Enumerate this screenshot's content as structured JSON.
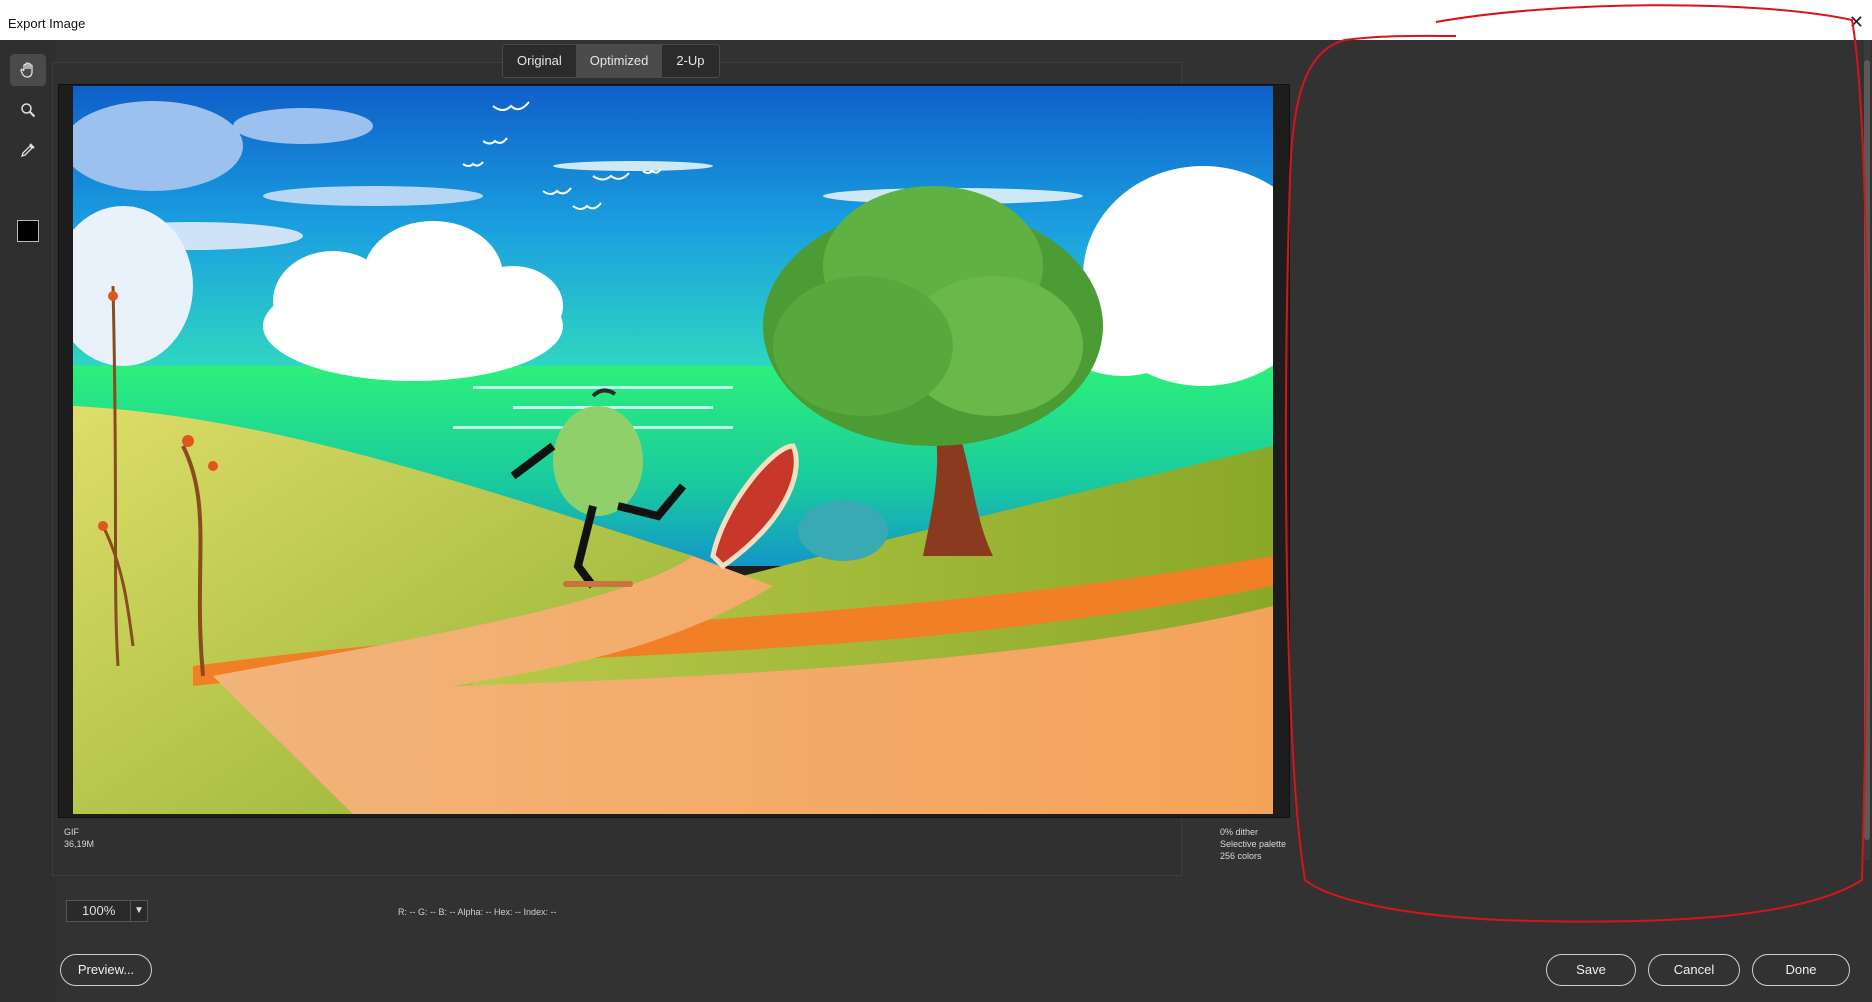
{
  "window": {
    "title": "Export Image",
    "close_glyph": "✕"
  },
  "tools": [
    {
      "icon": "hand-icon"
    },
    {
      "icon": "zoom-icon"
    },
    {
      "icon": "eyedropper-icon"
    },
    {
      "icon": "color-swatch-icon"
    }
  ],
  "tabs": [
    {
      "label": "Original",
      "active": false
    },
    {
      "label": "Optimized",
      "active": true
    },
    {
      "label": "2-Up",
      "active": false
    }
  ],
  "preview_info": {
    "format": "GIF",
    "size": "36,19M",
    "dither": "0% dither",
    "palette": "Selective palette",
    "colors": "256 colors"
  },
  "zoom": {
    "value": "100%"
  },
  "pixel_readout": "R: -- G: -- B: -- Alpha: -- Hex: -- Index: --",
  "buttons": {
    "preview": "Preview...",
    "save": "Save",
    "cancel": "Cancel",
    "done": "Done"
  },
  "colors": {
    "annotation": "#d6151b",
    "background": "#323232",
    "sky": "#1a7fd6",
    "sea": "#27e680"
  }
}
